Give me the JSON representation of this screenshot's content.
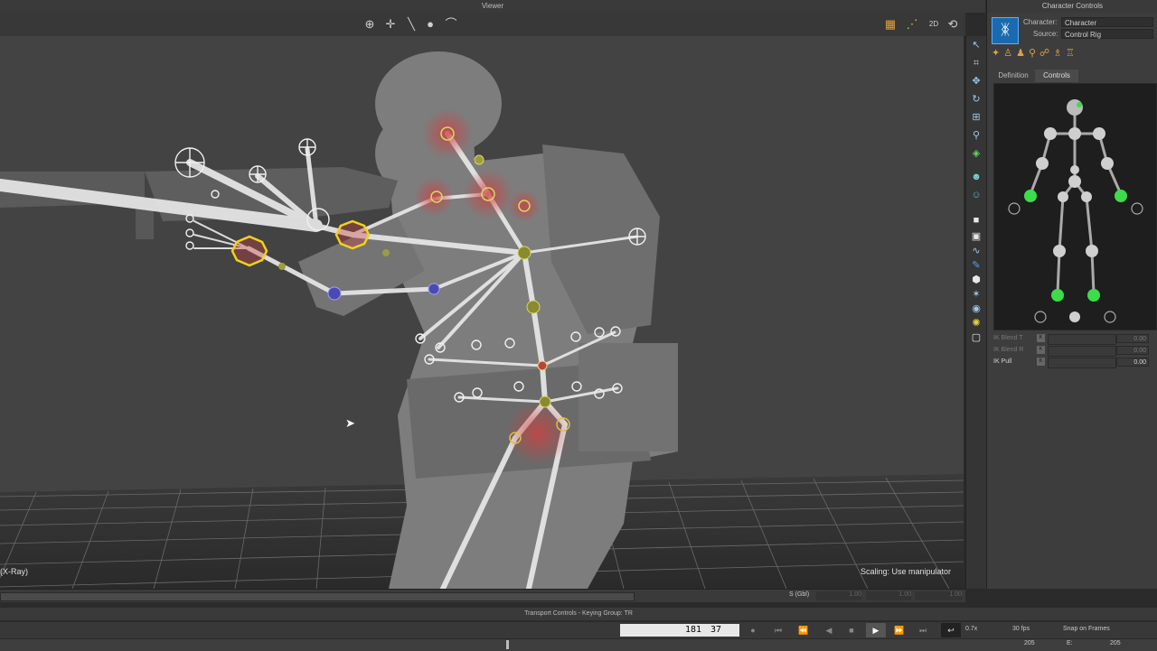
{
  "viewer": {
    "title": "Viewer",
    "mode_label": "(X-Ray)",
    "status_message": "Scaling: Use manipulator",
    "toolbar_right_label": "2D"
  },
  "character_controls": {
    "title": "Character Controls",
    "character_label": "Character:",
    "character_value": "Character",
    "source_label": "Source:",
    "source_value": "Control Rig",
    "tabs": [
      {
        "label": "Definition",
        "active": false
      },
      {
        "label": "Controls",
        "active": true
      }
    ],
    "sliders": [
      {
        "label": "IK Blend T",
        "value": "0.00",
        "enabled": false
      },
      {
        "label": "IK Blend R",
        "value": "0.00",
        "enabled": false
      },
      {
        "label": "IK Pull",
        "value": "0.00",
        "enabled": true
      }
    ]
  },
  "status_bar": {
    "s_label": "S (Gbl)",
    "fields": [
      "1.00",
      "1.00",
      "1.00"
    ]
  },
  "transport": {
    "title": "Transport Controls - Keying Group: TR",
    "current_frame_a": "181",
    "current_frame_b": "37",
    "speed": "0.7x",
    "fps": "30 fps",
    "snap": "Snap on Frames"
  },
  "timeline": {
    "end_value": "205",
    "e_label": "E:",
    "e_value": "205"
  },
  "colors": {
    "accent_blue": "#3fa0e0",
    "effector_green": "#3ddc4a",
    "selection_yellow": "#f2d21a",
    "pivot_red": "#c83c3c"
  }
}
